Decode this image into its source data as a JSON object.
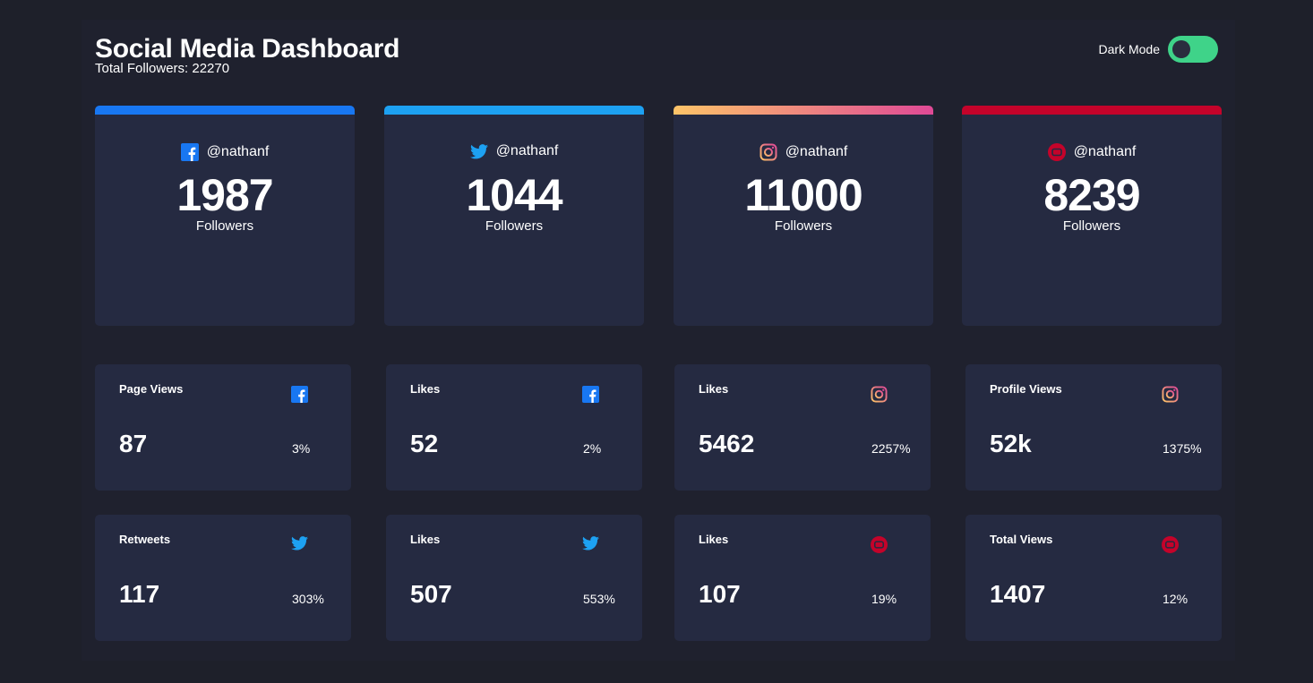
{
  "header": {
    "title": "Social Media Dashboard",
    "total_followers": "Total Followers: 22270",
    "dark_mode_label": "Dark Mode",
    "dark_mode_on": true
  },
  "colors": {
    "background": "#1e202a",
    "card": "#252a41",
    "toggle": "#3fd389",
    "facebook": "#1877f2",
    "twitter": "#1da1f2",
    "instagram_start": "#fdc468",
    "instagram_end": "#df4996",
    "youtube": "#c4032a"
  },
  "big_cards": [
    {
      "platform": "facebook",
      "icon": "facebook-icon",
      "handle": "@nathanf",
      "count": "1987",
      "label": "Followers"
    },
    {
      "platform": "twitter",
      "icon": "twitter-icon",
      "handle": "@nathanf",
      "count": "1044",
      "label": "Followers"
    },
    {
      "platform": "instagram",
      "icon": "instagram-icon",
      "handle": "@nathanf",
      "count": "11000",
      "label": "Followers"
    },
    {
      "platform": "youtube",
      "icon": "youtube-icon",
      "handle": "@nathanf",
      "count": "8239",
      "label": "Followers"
    }
  ],
  "small_cards": [
    {
      "metric": "Page Views",
      "icon": "facebook-icon",
      "value": "87",
      "percent": "3%"
    },
    {
      "metric": "Likes",
      "icon": "facebook-icon",
      "value": "52",
      "percent": "2%"
    },
    {
      "metric": "Likes",
      "icon": "instagram-icon",
      "value": "5462",
      "percent": "2257%"
    },
    {
      "metric": "Profile Views",
      "icon": "instagram-icon",
      "value": "52k",
      "percent": "1375%"
    },
    {
      "metric": "Retweets",
      "icon": "twitter-icon",
      "value": "117",
      "percent": "303%"
    },
    {
      "metric": "Likes",
      "icon": "twitter-icon",
      "value": "507",
      "percent": "553%"
    },
    {
      "metric": "Likes",
      "icon": "youtube-icon",
      "value": "107",
      "percent": "19%"
    },
    {
      "metric": "Total Views",
      "icon": "youtube-icon",
      "value": "1407",
      "percent": "12%"
    }
  ]
}
